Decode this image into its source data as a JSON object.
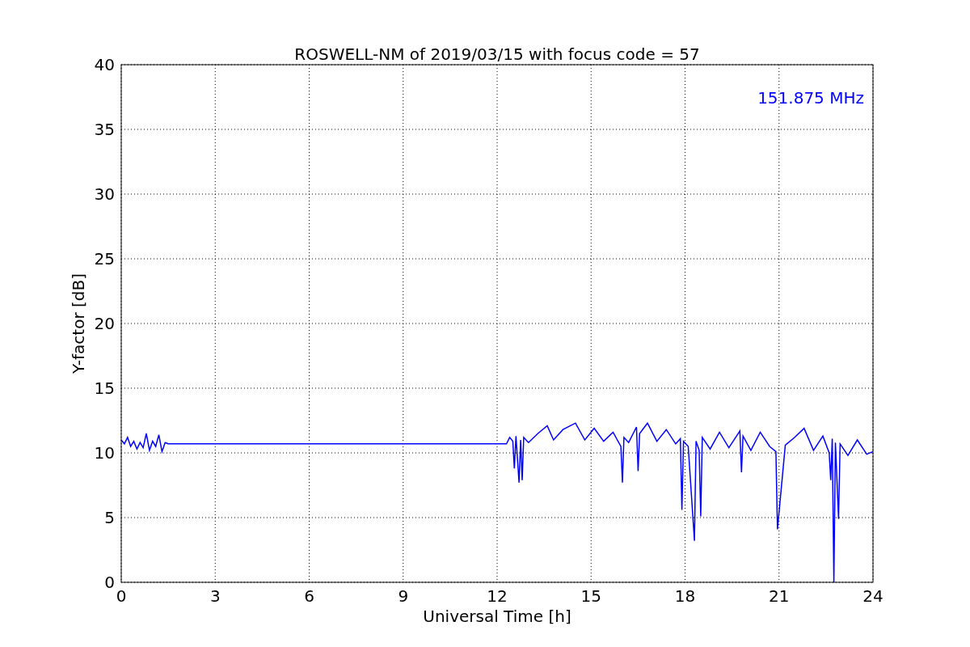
{
  "chart_data": {
    "type": "line",
    "title": "ROSWELL-NM of 2019/03/15 with focus code = 57",
    "xlabel": "Universal Time [h]",
    "ylabel": "Y-factor [dB]",
    "x": [
      0,
      0.1,
      0.2,
      0.3,
      0.4,
      0.5,
      0.6,
      0.7,
      0.8,
      0.9,
      1.0,
      1.1,
      1.2,
      1.3,
      1.4,
      1.5,
      12.3,
      12.4,
      12.5,
      12.55,
      12.6,
      12.7,
      12.75,
      12.8,
      12.85,
      13.0,
      13.3,
      13.6,
      13.8,
      14.1,
      14.5,
      14.8,
      15.1,
      15.4,
      15.7,
      15.95,
      16.0,
      16.05,
      16.2,
      16.45,
      16.5,
      16.55,
      16.8,
      17.1,
      17.4,
      17.7,
      17.85,
      17.9,
      17.95,
      18.1,
      18.3,
      18.35,
      18.45,
      18.5,
      18.55,
      18.8,
      19.1,
      19.4,
      19.75,
      19.8,
      19.85,
      20.1,
      20.4,
      20.7,
      20.9,
      20.95,
      21.2,
      21.5,
      21.8,
      22.1,
      22.4,
      22.6,
      22.65,
      22.7,
      22.75,
      22.8,
      22.9,
      22.95,
      23.2,
      23.5,
      23.8,
      24
    ],
    "series": [
      {
        "name": "151.875 MHz",
        "color": "#0000ff",
        "values": [
          11.0,
          10.7,
          11.2,
          10.5,
          10.9,
          10.3,
          10.8,
          10.4,
          11.5,
          10.2,
          10.9,
          10.5,
          11.4,
          10.1,
          10.8,
          10.7,
          10.7,
          11.2,
          10.9,
          8.8,
          11.3,
          7.7,
          11.0,
          7.9,
          11.2,
          10.8,
          11.5,
          12.1,
          11.0,
          11.8,
          12.3,
          11.0,
          11.9,
          10.9,
          11.6,
          10.5,
          7.7,
          11.2,
          10.8,
          12.0,
          8.6,
          11.5,
          12.3,
          10.9,
          11.8,
          10.7,
          11.1,
          5.6,
          10.9,
          10.5,
          3.2,
          10.9,
          10.2,
          5.1,
          11.2,
          10.3,
          11.6,
          10.4,
          11.7,
          8.5,
          11.3,
          10.2,
          11.6,
          10.5,
          10.1,
          4.1,
          10.6,
          11.2,
          11.9,
          10.2,
          11.3,
          10.0,
          7.9,
          11.1,
          0,
          10.8,
          4.9,
          10.7,
          9.8,
          11.0,
          9.9,
          10.1
        ]
      }
    ],
    "xlim": [
      0,
      24
    ],
    "ylim": [
      0,
      40
    ],
    "xticks": [
      0,
      3,
      6,
      9,
      12,
      15,
      18,
      21,
      24
    ],
    "yticks": [
      0,
      5,
      10,
      15,
      20,
      25,
      30,
      35,
      40
    ],
    "grid": true
  }
}
